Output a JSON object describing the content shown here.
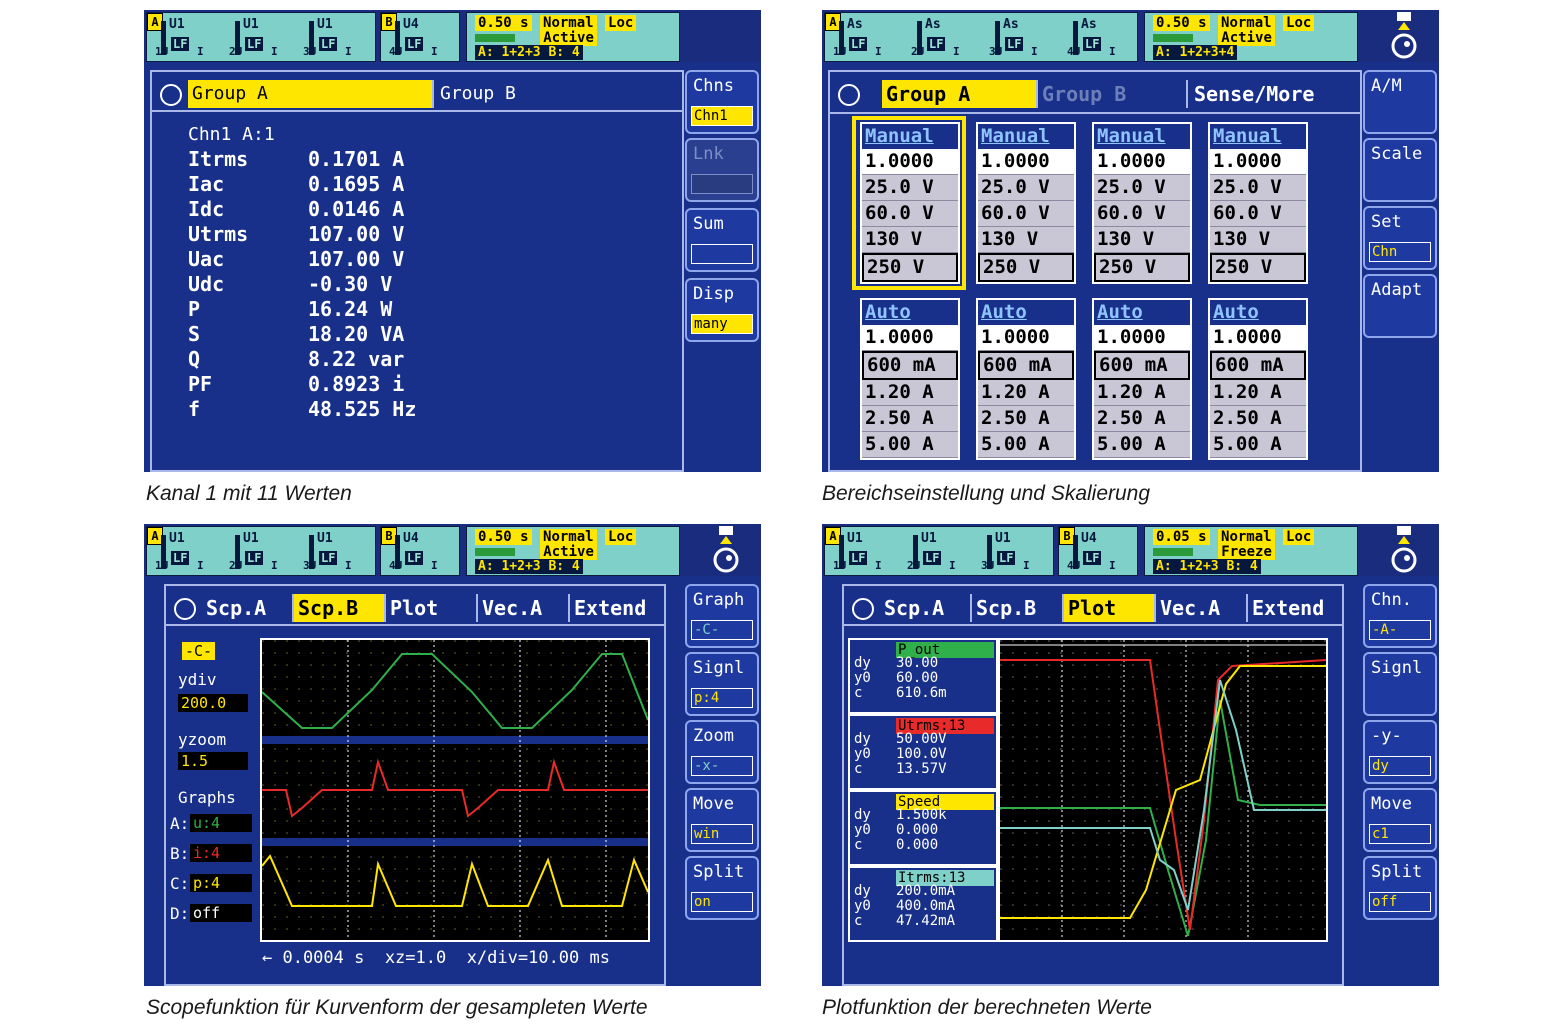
{
  "captions": [
    "Kanal 1 mit 11 Werten",
    "Bereichseinstellung und Skalierung",
    "Scopefunktion für Kurvenform der gesampleten Werte",
    "Plotfunktion der berechneten Werte"
  ],
  "status_common": {
    "group_a": "A",
    "group_b": "B",
    "unit_u": "U",
    "unit_i": "I",
    "lf": "LF"
  },
  "p1": {
    "channels": [
      {
        "top": "U1",
        "num": "1"
      },
      {
        "top": "U1",
        "num": "2"
      },
      {
        "top": "U1",
        "num": "3"
      },
      {
        "top": "U4",
        "num": "4"
      }
    ],
    "cycle": "0.50 s",
    "mode": "Normal",
    "loc": "Loc",
    "state": "Active",
    "groups": "A: 1+2+3  B: 4",
    "tabs": [
      "Group A",
      "Group B"
    ],
    "chn_header": "Chn1   A:1",
    "values": [
      [
        "Itrms",
        "0.1701 A"
      ],
      [
        "Iac",
        "0.1695 A"
      ],
      [
        "Idc",
        "0.0146 A"
      ],
      [
        "Utrms",
        "107.00 V"
      ],
      [
        "Uac",
        "107.00 V"
      ],
      [
        "Udc",
        "-0.30 V"
      ],
      [
        "P",
        "16.24 W"
      ],
      [
        "S",
        "18.20 VA"
      ],
      [
        "Q",
        "8.22 var"
      ],
      [
        "PF",
        "0.8923 i"
      ],
      [
        "f",
        "48.525 Hz"
      ]
    ],
    "softkeys": [
      {
        "label": "Chns",
        "value": "Chn1"
      },
      {
        "label": "Lnk",
        "value": ""
      },
      {
        "label": "Sum",
        "value": ""
      },
      {
        "label": "Disp",
        "value": "many"
      }
    ]
  },
  "p2": {
    "channels": [
      {
        "top": "As",
        "num": "1"
      },
      {
        "top": "As",
        "num": "2"
      },
      {
        "top": "As",
        "num": "3"
      },
      {
        "top": "As",
        "num": "4"
      }
    ],
    "cycle": "0.50 s",
    "mode": "Normal",
    "loc": "Loc",
    "state": "Active",
    "groups": "A: 1+2+3+4",
    "tabs": [
      "Group A",
      "Group B",
      "Sense/More"
    ],
    "voltage_cols": [
      [
        "Manual",
        "1.0000",
        "25.0 V",
        "60.0 V",
        "130 V",
        "250 V"
      ],
      [
        "Manual",
        "1.0000",
        "25.0 V",
        "60.0 V",
        "130 V",
        "250 V"
      ],
      [
        "Manual",
        "1.0000",
        "25.0 V",
        "60.0 V",
        "130 V",
        "250 V"
      ],
      [
        "Manual",
        "1.0000",
        "25.0 V",
        "60.0 V",
        "130 V",
        "250 V"
      ]
    ],
    "current_cols": [
      [
        "Auto",
        "1.0000",
        "600 mA",
        "1.20 A",
        "2.50 A",
        "5.00 A"
      ],
      [
        "Auto",
        "1.0000",
        "600 mA",
        "1.20 A",
        "2.50 A",
        "5.00 A"
      ],
      [
        "Auto",
        "1.0000",
        "600 mA",
        "1.20 A",
        "2.50 A",
        "5.00 A"
      ],
      [
        "Auto",
        "1.0000",
        "600 mA",
        "1.20 A",
        "2.50 A",
        "5.00 A"
      ]
    ],
    "softkeys": [
      {
        "label": "A/M",
        "value": ""
      },
      {
        "label": "Scale",
        "value": ""
      },
      {
        "label": "Set",
        "value": "Chn"
      },
      {
        "label": "Adapt",
        "value": ""
      }
    ]
  },
  "p3": {
    "channels": [
      {
        "top": "U1",
        "num": "1"
      },
      {
        "top": "U1",
        "num": "2"
      },
      {
        "top": "U1",
        "num": "3"
      },
      {
        "top": "U4",
        "num": "4"
      }
    ],
    "cycle": "0.50 s",
    "mode": "Normal",
    "loc": "Loc",
    "state": "Active",
    "groups": "A: 1+2+3  B: 4",
    "tabs": [
      "Scp.A",
      "Scp.B",
      "Plot",
      "Vec.A",
      "Extend"
    ],
    "side": {
      "c": "-C-",
      "ydiv_label": "ydiv",
      "ydiv": "200.0",
      "yzoom_label": "yzoom",
      "yzoom": "1.5",
      "graphs_label": "Graphs",
      "a_lbl": "A:",
      "a": "u:4",
      "b_lbl": "B:",
      "b": "i:4",
      "c_lbl": "C:",
      "cval": "p:4",
      "d_lbl": "D:",
      "d": "off"
    },
    "footer": "← 0.0004 s  xz=1.0  x/div=10.00 ms",
    "softkeys": [
      {
        "label": "Graph",
        "value": "-C-"
      },
      {
        "label": "Signl",
        "value": "p:4"
      },
      {
        "label": "Zoom",
        "value": "-x-"
      },
      {
        "label": "Move",
        "value": "win"
      },
      {
        "label": "Split",
        "value": "on"
      }
    ]
  },
  "p4": {
    "channels": [
      {
        "top": "U1",
        "num": "1"
      },
      {
        "top": "U1",
        "num": "2"
      },
      {
        "top": "U1",
        "num": "3"
      },
      {
        "top": "U4",
        "num": "4"
      }
    ],
    "cycle": "0.05 s",
    "mode": "Normal",
    "loc": "Loc",
    "state": "Freeze",
    "groups": "A: 1+2+3  B: 4",
    "tabs": [
      "Scp.A",
      "Scp.B",
      "Plot",
      "Vec.A",
      "Extend"
    ],
    "series": [
      {
        "name": "P_out",
        "dy": "30.00",
        "y0": "60.00",
        "c": "610.6m",
        "color": "#2fb04a"
      },
      {
        "name": "Utrms:13",
        "dy": "50.00V",
        "y0": "100.0V",
        "c": "13.57V",
        "color": "#e82a2a"
      },
      {
        "name": "Speed",
        "dy": "1.500k",
        "y0": "0.000",
        "c": "0.000",
        "color": "#ffe600"
      },
      {
        "name": "Itrms:13",
        "dy": "200.0mA",
        "y0": "400.0mA",
        "c": "47.42mA",
        "color": "#7fd0c8"
      }
    ],
    "row_labels": [
      "dy",
      "y0",
      "c"
    ],
    "softkeys": [
      {
        "label": "Chn.",
        "value": "-A-"
      },
      {
        "label": "Signl",
        "value": ""
      },
      {
        "label": "-y-",
        "value": "dy"
      },
      {
        "label": "Move",
        "value": "c1"
      },
      {
        "label": "Split",
        "value": "off"
      }
    ]
  }
}
